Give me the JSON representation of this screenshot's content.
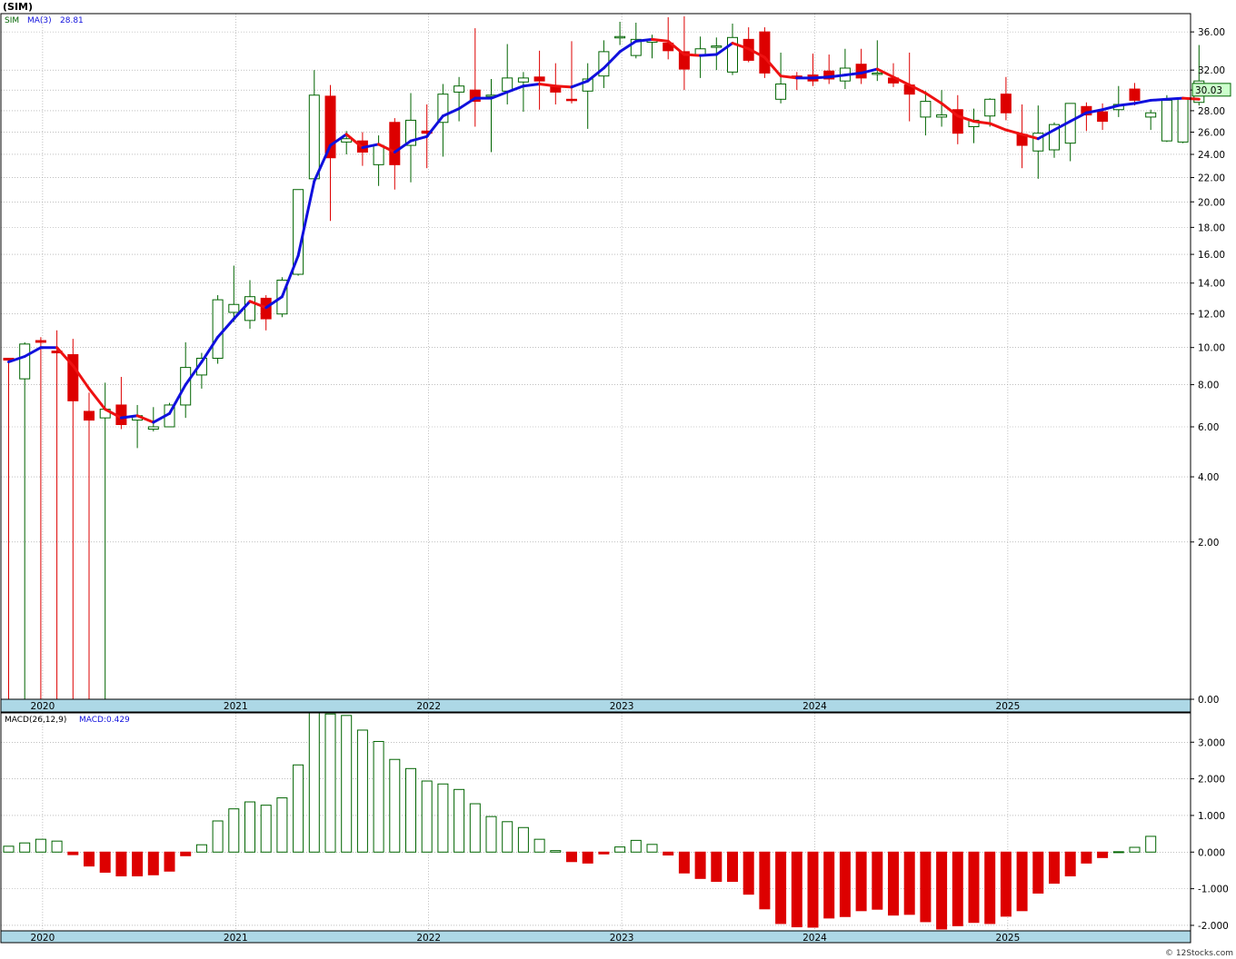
{
  "title": "(SIM)",
  "credit": "© 12Stocks.com",
  "colors": {
    "up": "#006400",
    "down": "#dd0000",
    "ma_up": "#1010dd",
    "ma_down": "#ee1111",
    "axis_band": "#add8e6",
    "grid": "#999999",
    "price_tag_bg": "#ccffcc"
  },
  "chart_data": [
    {
      "type": "candlestick",
      "name": "price",
      "legend": {
        "symbol": "SIM",
        "ma_label": "MA(3)",
        "ma_value": "28.81"
      },
      "last_price": "30.03",
      "scale": "sqrt",
      "ylim": [
        0,
        38
      ],
      "ytick_labels": [
        "0.00",
        "2.00",
        "4.00",
        "6.00",
        "8.00",
        "10.00",
        "12.00",
        "14.00",
        "16.00",
        "18.00",
        "20.00",
        "22.00",
        "24.00",
        "26.00",
        "28.00",
        "30.00",
        "32.00",
        "36.00"
      ],
      "x_labels": [
        {
          "label": "2020",
          "i": 2
        },
        {
          "label": "2021",
          "i": 14
        },
        {
          "label": "2022",
          "i": 26
        },
        {
          "label": "2023",
          "i": 38
        },
        {
          "label": "2024",
          "i": 50
        },
        {
          "label": "2025",
          "i": 62
        }
      ],
      "candles": [
        [
          9.4,
          9.4,
          0,
          9.3
        ],
        [
          8.3,
          10.3,
          0,
          10.2
        ],
        [
          10.4,
          10.6,
          0,
          10.3
        ],
        [
          9.8,
          11.0,
          0,
          9.7
        ],
        [
          9.6,
          10.5,
          0,
          7.2
        ],
        [
          6.7,
          7.6,
          0,
          6.3
        ],
        [
          6.4,
          8.1,
          0,
          6.8
        ],
        [
          7.0,
          8.4,
          5.9,
          6.1
        ],
        [
          6.3,
          7.0,
          5.1,
          6.5
        ],
        [
          5.9,
          6.9,
          5.8,
          6.0
        ],
        [
          6.0,
          7.1,
          6.0,
          7.0
        ],
        [
          7.0,
          10.3,
          6.4,
          8.9
        ],
        [
          8.5,
          9.7,
          7.8,
          9.4
        ],
        [
          9.4,
          13.2,
          9.1,
          12.9
        ],
        [
          12.1,
          15.2,
          11.5,
          12.6
        ],
        [
          11.6,
          14.2,
          11.1,
          13.1
        ],
        [
          13.0,
          13.2,
          11.0,
          11.7
        ],
        [
          12.0,
          14.4,
          11.8,
          14.2
        ],
        [
          14.6,
          16.8,
          14.5,
          21.0
        ],
        [
          21.9,
          32.0,
          21.5,
          29.5
        ],
        [
          29.4,
          30.5,
          18.5,
          23.7
        ],
        [
          25.1,
          26.1,
          24.0,
          25.4
        ],
        [
          25.2,
          26.0,
          23.0,
          24.2
        ],
        [
          23.1,
          25.7,
          21.3,
          24.8
        ],
        [
          26.9,
          27.3,
          21.0,
          23.1
        ],
        [
          24.8,
          29.7,
          21.6,
          27.1
        ],
        [
          26.1,
          28.6,
          22.8,
          25.9
        ],
        [
          26.9,
          30.6,
          23.8,
          29.6
        ],
        [
          29.8,
          31.3,
          27.0,
          30.4
        ],
        [
          30.0,
          36.4,
          26.5,
          28.9
        ],
        [
          29.4,
          31.1,
          24.2,
          29.5
        ],
        [
          29.9,
          34.7,
          28.6,
          31.2
        ],
        [
          30.8,
          31.8,
          27.9,
          31.2
        ],
        [
          31.3,
          34.0,
          28.1,
          30.9
        ],
        [
          30.3,
          32.7,
          28.6,
          29.8
        ],
        [
          29.1,
          35.0,
          28.7,
          29.0
        ],
        [
          29.9,
          32.7,
          26.3,
          31.1
        ],
        [
          31.4,
          35.1,
          30.2,
          33.9
        ],
        [
          35.4,
          37.1,
          34.6,
          35.5
        ],
        [
          33.5,
          37.0,
          33.2,
          35.2
        ],
        [
          34.9,
          35.7,
          33.2,
          35.1
        ],
        [
          34.8,
          37.6,
          33.1,
          34.0
        ],
        [
          33.9,
          37.7,
          30.0,
          32.1
        ],
        [
          33.6,
          35.5,
          31.2,
          34.2
        ],
        [
          34.4,
          35.4,
          32.0,
          34.5
        ],
        [
          31.8,
          36.9,
          31.5,
          35.4
        ],
        [
          35.2,
          36.5,
          32.8,
          33.0
        ],
        [
          36.0,
          36.5,
          31.2,
          31.7
        ],
        [
          29.1,
          33.8,
          28.7,
          30.6
        ],
        [
          31.4,
          31.8,
          30.0,
          31.2
        ],
        [
          31.5,
          33.7,
          30.4,
          30.9
        ],
        [
          31.9,
          33.6,
          30.6,
          31.1
        ],
        [
          30.9,
          34.2,
          30.1,
          32.2
        ],
        [
          32.6,
          34.2,
          30.6,
          31.2
        ],
        [
          31.6,
          35.1,
          30.9,
          31.7
        ],
        [
          31.2,
          32.7,
          30.3,
          30.7
        ],
        [
          30.5,
          33.8,
          27.0,
          29.6
        ],
        [
          27.4,
          29.9,
          25.7,
          28.9
        ],
        [
          27.4,
          30.0,
          26.5,
          27.6
        ],
        [
          28.1,
          29.5,
          24.9,
          25.9
        ],
        [
          26.5,
          28.2,
          25.0,
          27.1
        ],
        [
          27.5,
          29.2,
          26.5,
          29.1
        ],
        [
          29.6,
          31.3,
          27.1,
          27.8
        ],
        [
          25.8,
          28.6,
          22.8,
          24.8
        ],
        [
          24.3,
          28.5,
          21.9,
          25.9
        ],
        [
          24.4,
          26.9,
          23.7,
          26.7
        ],
        [
          25.0,
          27.0,
          23.4,
          28.7
        ],
        [
          28.4,
          28.8,
          26.1,
          27.6
        ],
        [
          27.9,
          28.7,
          26.2,
          27.0
        ],
        [
          28.1,
          30.4,
          27.4,
          28.6
        ],
        [
          30.1,
          30.7,
          28.5,
          29.0
        ],
        [
          27.4,
          28.1,
          26.2,
          27.8
        ],
        [
          25.2,
          29.5,
          25.1,
          29.0
        ],
        [
          25.1,
          29.1,
          25.0,
          29.2
        ],
        [
          28.8,
          34.6,
          28.5,
          30.9
        ]
      ],
      "ma": [
        9.2,
        9.5,
        10.0,
        10.0,
        9.0,
        7.8,
        6.8,
        6.4,
        6.5,
        6.2,
        6.6,
        8.0,
        9.2,
        10.6,
        11.7,
        12.8,
        12.4,
        13.1,
        15.9,
        21.7,
        24.8,
        25.8,
        24.6,
        24.9,
        24.2,
        25.2,
        25.6,
        27.5,
        28.2,
        29.2,
        29.2,
        29.8,
        30.4,
        30.6,
        30.4,
        30.3,
        30.9,
        32.2,
        33.9,
        35.0,
        35.2,
        35.0,
        33.6,
        33.5,
        33.6,
        34.8,
        34.2,
        33.3,
        31.4,
        31.2,
        31.2,
        31.3,
        31.5,
        31.7,
        32.1,
        31.3,
        30.5,
        29.7,
        28.7,
        27.5,
        27.0,
        26.8,
        26.2,
        25.8,
        25.4,
        26.2,
        27.0,
        27.8,
        28.1,
        28.5,
        28.7,
        29.0,
        29.1,
        29.2,
        29.1
      ]
    },
    {
      "type": "bar",
      "name": "macd",
      "legend": {
        "label": "MACD(26,12,9)",
        "value_label": "MACD:0.429"
      },
      "ylim": [
        -2.15,
        3.8
      ],
      "ytick_labels": [
        "-2.000",
        "-1.000",
        "0.000",
        "1.000",
        "2.000",
        "3.000"
      ],
      "x_labels": [
        {
          "label": "2020",
          "i": 2
        },
        {
          "label": "2021",
          "i": 14
        },
        {
          "label": "2022",
          "i": 26
        },
        {
          "label": "2023",
          "i": 38
        },
        {
          "label": "2024",
          "i": 50
        },
        {
          "label": "2025",
          "i": 62
        }
      ],
      "values": [
        0.16,
        0.25,
        0.35,
        0.3,
        -0.07,
        -0.38,
        -0.55,
        -0.65,
        -0.65,
        -0.62,
        -0.52,
        -0.1,
        0.2,
        0.85,
        1.18,
        1.37,
        1.28,
        1.48,
        2.38,
        3.8,
        3.77,
        3.73,
        3.33,
        3.02,
        2.53,
        2.28,
        1.94,
        1.86,
        1.71,
        1.32,
        0.97,
        0.83,
        0.67,
        0.35,
        0.04,
        -0.26,
        -0.3,
        -0.05,
        0.14,
        0.32,
        0.21,
        -0.08,
        -0.57,
        -0.72,
        -0.8,
        -0.8,
        -1.15,
        -1.55,
        -1.95,
        -2.04,
        -2.05,
        -1.8,
        -1.76,
        -1.6,
        -1.56,
        -1.72,
        -1.7,
        -1.9,
        -2.1,
        -2.01,
        -1.92,
        -1.95,
        -1.75,
        -1.6,
        -1.12,
        -0.85,
        -0.65,
        -0.3,
        -0.15,
        0.01,
        0.13,
        0.43
      ]
    }
  ]
}
